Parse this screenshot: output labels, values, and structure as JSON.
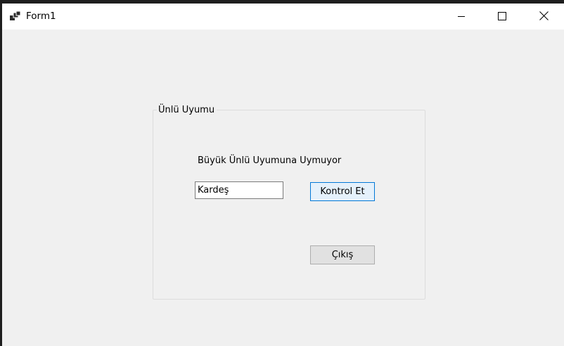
{
  "window": {
    "title": "Form1",
    "icons": {
      "app": "form-app-icon",
      "minimize": "minimize-icon",
      "maximize": "maximize-icon",
      "close": "close-icon"
    }
  },
  "groupbox": {
    "title": "Ünlü Uyumu",
    "result_label": "Büyük Ünlü Uyumuna Uymuyor",
    "word_input": {
      "value": "Kardeş",
      "placeholder": ""
    },
    "check_button_label": "Kontrol Et",
    "exit_button_label": "Çıkış"
  },
  "colors": {
    "form_background": "#f0f0f0",
    "title_bar": "#ffffff",
    "focused_button_border": "#0078d7",
    "focused_button_fill": "#e5f1fb",
    "button_fill": "#e1e1e1"
  }
}
